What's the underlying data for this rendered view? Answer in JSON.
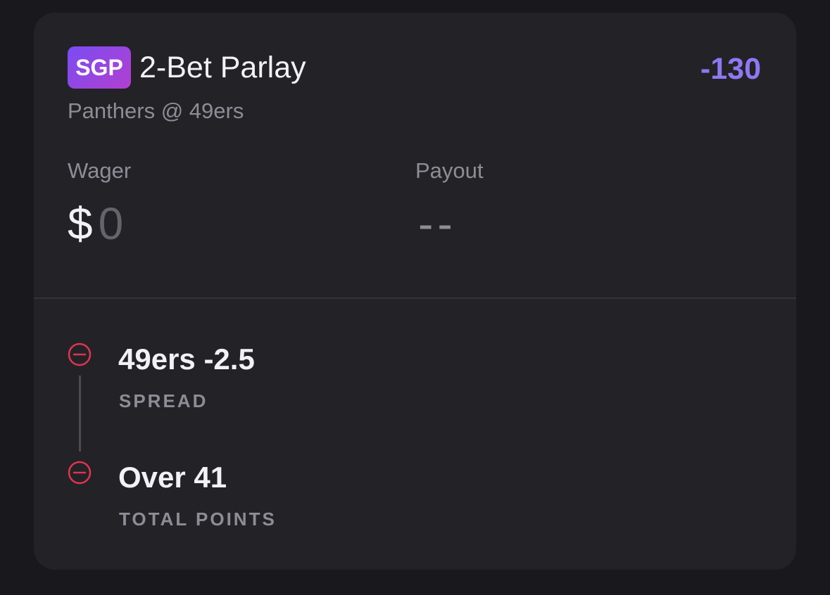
{
  "bet": {
    "badge": "SGP",
    "title": "2-Bet Parlay",
    "odds": "-130",
    "matchup": "Panthers @ 49ers"
  },
  "wager": {
    "label": "Wager",
    "currency": "$",
    "value": "0"
  },
  "payout": {
    "label": "Payout",
    "value": "--"
  },
  "legs": [
    {
      "name": "49ers -2.5",
      "type": "SPREAD",
      "icon": "remove-circle-icon"
    },
    {
      "name": "Over 41",
      "type": "TOTAL POINTS",
      "icon": "remove-circle-icon"
    }
  ],
  "colors": {
    "background": "#19181c",
    "card": "#232227",
    "accent_odds": "#8f78f2",
    "remove_icon": "#e0344f",
    "badge_gradient_start": "#7a4cf2",
    "badge_gradient_end": "#b23fd0"
  }
}
